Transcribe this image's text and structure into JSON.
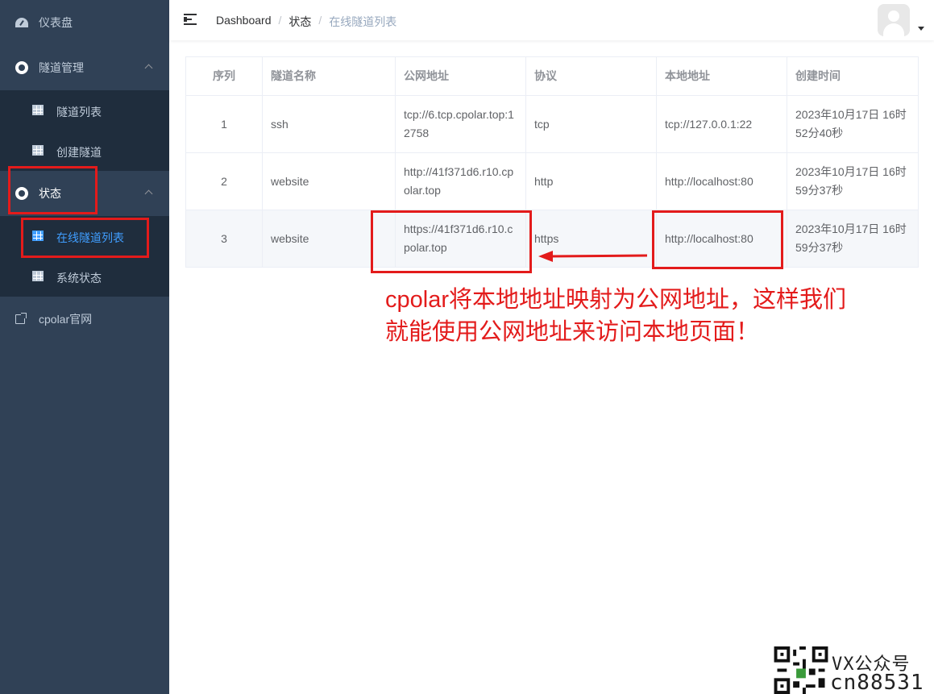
{
  "sidebar": {
    "dashboard": {
      "label": "仪表盘",
      "icon": "dashboard-icon"
    },
    "tunnel_mgmt": {
      "label": "隧道管理",
      "icon": "circle-icon",
      "children": [
        {
          "label": "隧道列表",
          "icon": "table-icon"
        },
        {
          "label": "创建隧道",
          "icon": "table-icon"
        }
      ]
    },
    "status": {
      "label": "状态",
      "icon": "circle-icon",
      "children": [
        {
          "label": "在线隧道列表",
          "icon": "table-icon",
          "active": true
        },
        {
          "label": "系统状态",
          "icon": "table-icon"
        }
      ]
    },
    "website": {
      "label": "cpolar官网",
      "icon": "external-link-icon"
    }
  },
  "header": {
    "breadcrumb": [
      "Dashboard",
      "状态",
      "在线隧道列表"
    ]
  },
  "table": {
    "columns": [
      "序列",
      "隧道名称",
      "公网地址",
      "协议",
      "本地地址",
      "创建时间"
    ],
    "rows": [
      {
        "index": "1",
        "name": "ssh",
        "public_url": "tcp://6.tcp.cpolar.top:12758",
        "protocol": "tcp",
        "local_addr": "tcp://127.0.0.1:22",
        "created": "2023年10月17日 16时52分40秒"
      },
      {
        "index": "2",
        "name": "website",
        "public_url": "http://41f371d6.r10.cpolar.top",
        "protocol": "http",
        "local_addr": "http://localhost:80",
        "created": "2023年10月17日 16时59分37秒"
      },
      {
        "index": "3",
        "name": "website",
        "public_url": "https://41f371d6.r10.cpolar.top",
        "protocol": "https",
        "local_addr": "http://localhost:80",
        "created": "2023年10月17日 16时59分37秒"
      }
    ]
  },
  "annotation": {
    "text": "cpolar将本地地址映射为公网地址，这样我们就能使用公网地址来访问本地页面！",
    "color": "#e31b1b"
  },
  "watermark": {
    "line1": "VX公众号",
    "line2": "cn88531"
  },
  "colors": {
    "sidebar_bg": "#304156",
    "submenu_bg": "#1f2d3d",
    "active": "#409eff",
    "annotation": "#e31b1b"
  }
}
